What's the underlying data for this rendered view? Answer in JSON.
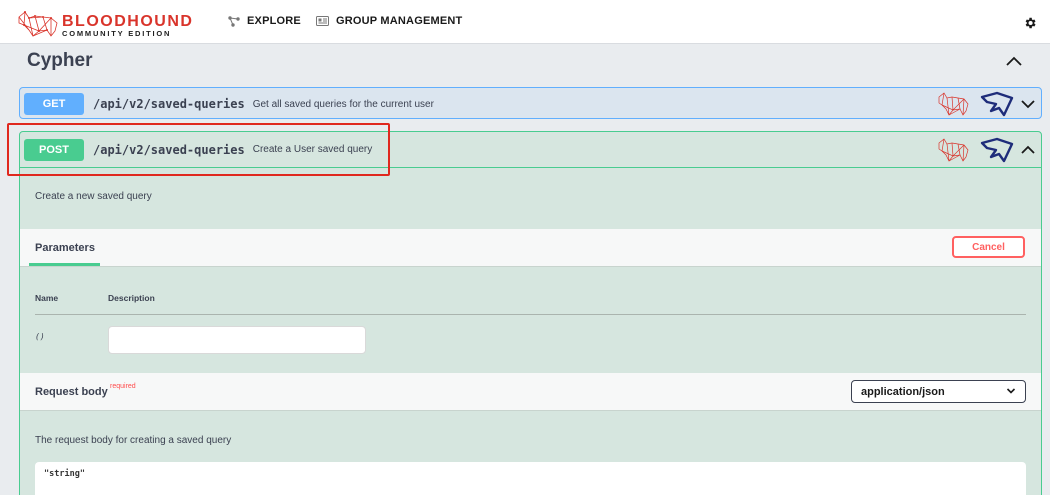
{
  "app": {
    "brand_title": "BLOODHOUND",
    "brand_subtitle": "COMMUNITY EDITION",
    "nav": [
      {
        "label": "EXPLORE",
        "icon": "graph-nodes-icon"
      },
      {
        "label": "GROUP MANAGEMENT",
        "icon": "id-card-icon"
      }
    ],
    "settings_icon": "gear-icon"
  },
  "section": {
    "title": "Cypher",
    "toggle_icon": "chevron-up-icon"
  },
  "operations": [
    {
      "method": "GET",
      "path": "/api/v2/saved-queries",
      "summary": "Get all saved queries for the current user",
      "expanded": false,
      "color": "#61affe"
    },
    {
      "method": "POST",
      "path": "/api/v2/saved-queries",
      "summary": "Create a User saved query",
      "expanded": true,
      "color": "#49cc90",
      "description": "Create a new saved query",
      "parameters": {
        "title": "Parameters",
        "cancel_label": "Cancel",
        "columns": {
          "name": "Name",
          "description": "Description"
        },
        "row": {
          "type": "()",
          "input_value": ""
        }
      },
      "request_body": {
        "title": "Request body",
        "required_label": "required",
        "content_type": "application/json",
        "description": "The request body for creating a saved query",
        "example": "\"string\""
      }
    }
  ],
  "colors": {
    "brand_red": "#d9342b",
    "get": "#61affe",
    "post": "#49cc90",
    "cancel": "#ff6060",
    "highlight": "#e0281e"
  }
}
